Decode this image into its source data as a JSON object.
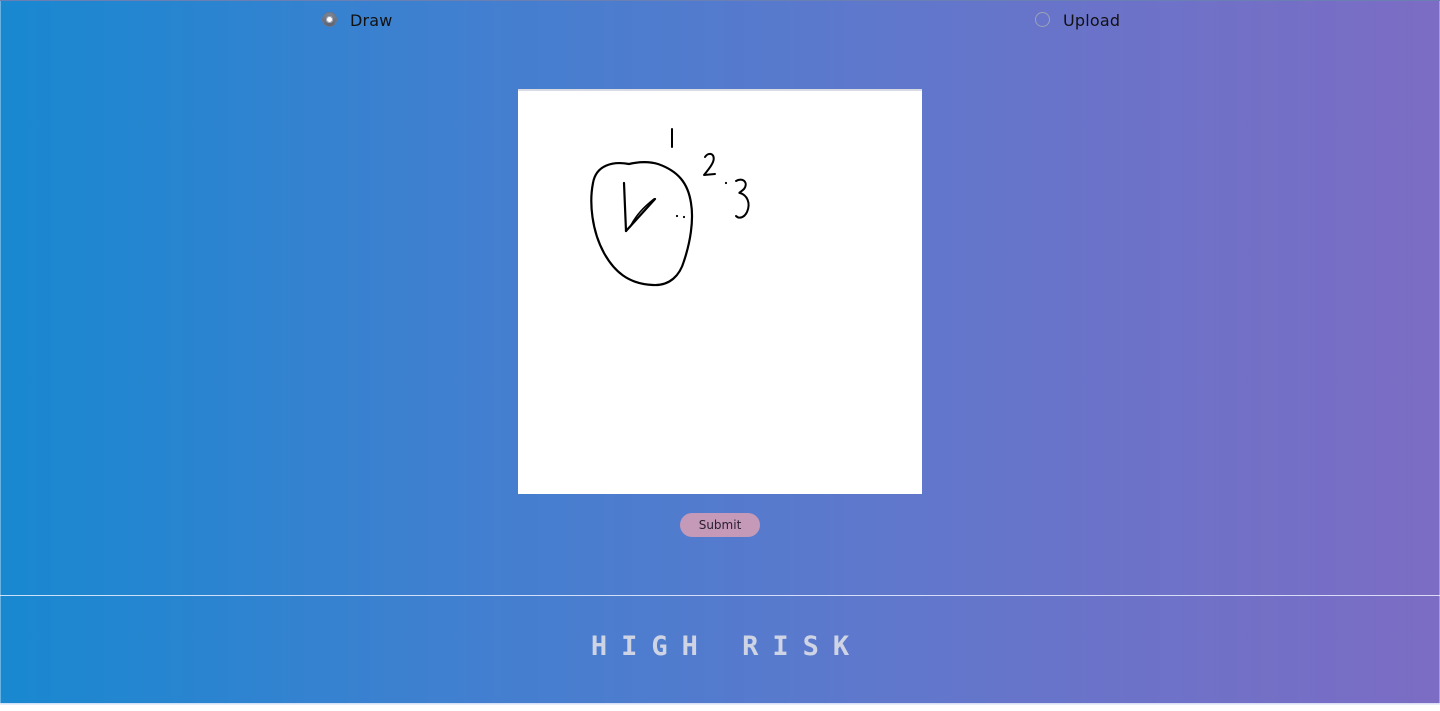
{
  "mode": {
    "options": [
      {
        "label": "Draw",
        "selected": true
      },
      {
        "label": "Upload",
        "selected": false
      }
    ]
  },
  "canvas": {
    "drawing": "hand-drawn clock with numbers 1, 2, 3 and hands",
    "digits": [
      "1",
      "2",
      "3"
    ]
  },
  "actions": {
    "submit_label": "Submit"
  },
  "result": {
    "text": "HIGH RISK"
  },
  "colors": {
    "gradient_start": "#1888d0",
    "gradient_end": "#7c6cc4",
    "submit_bg": "#c59ab8",
    "result_text": "#cfd4e4"
  }
}
